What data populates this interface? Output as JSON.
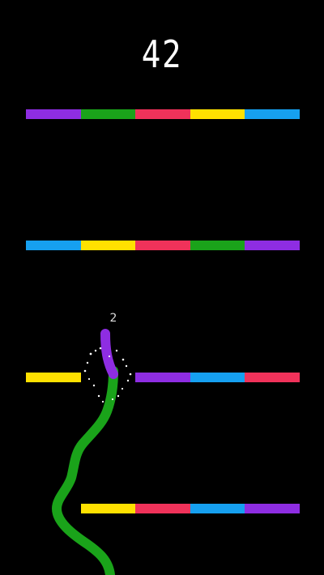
{
  "score": "42",
  "snake": {
    "length_label": "2",
    "head_color": "#8e2de2",
    "body_color": "#1aa31a"
  },
  "colors": {
    "purple": "#8e2de2",
    "green": "#1aa31a",
    "red": "#f0325a",
    "yellow": "#ffe100",
    "blue": "#16a0f0"
  },
  "rows": [
    {
      "segments": [
        "purple",
        "green",
        "red",
        "yellow",
        "blue"
      ]
    },
    {
      "segments": [
        "blue",
        "yellow",
        "red",
        "green",
        "purple"
      ]
    },
    {
      "segments": [
        "yellow",
        null,
        "purple",
        "blue",
        "red"
      ]
    },
    {
      "segments": [
        null,
        "yellow",
        "red",
        "blue",
        "purple"
      ]
    }
  ]
}
